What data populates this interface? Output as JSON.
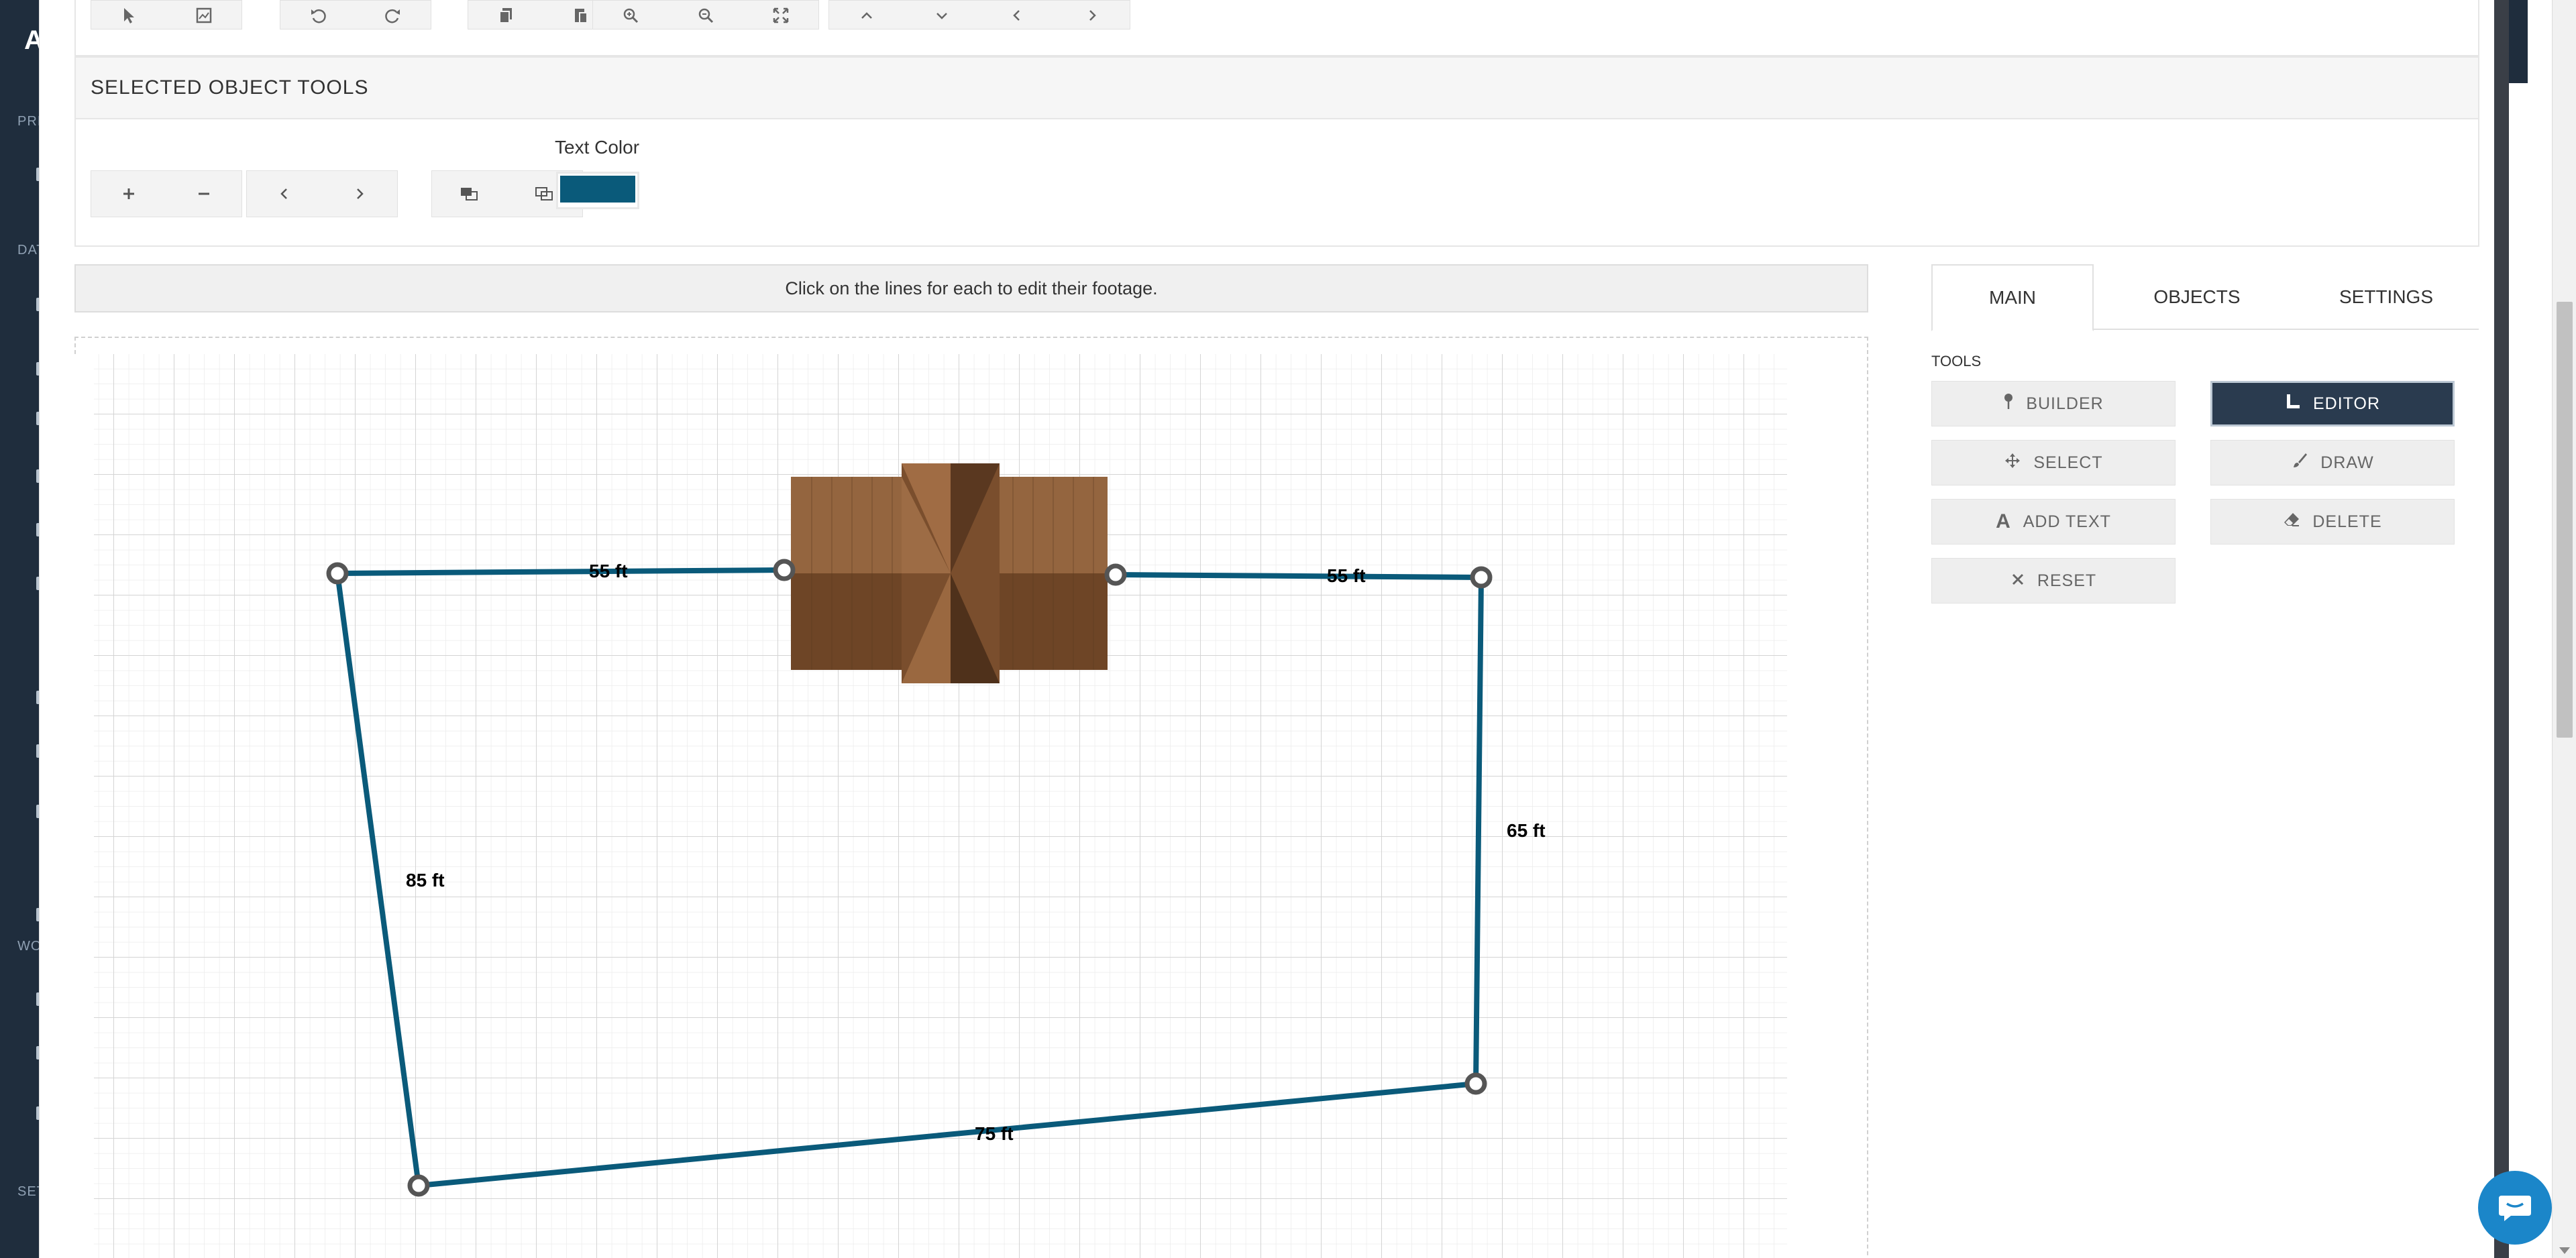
{
  "app_sidebar": {
    "logo": "A",
    "sections": [
      "PRI",
      "DAT",
      "WO",
      "SET"
    ]
  },
  "selected_object_tools": {
    "title": "SELECTED OBJECT TOOLS",
    "text_color_label": "Text Color",
    "text_color": "#0a5a7a"
  },
  "hint": "Click on the lines for each to edit their footage.",
  "diagram": {
    "line_color": "#0a5a7a",
    "labels": [
      "55 ft",
      "55 ft",
      "65 ft",
      "75 ft",
      "85 ft"
    ]
  },
  "tabs": [
    "MAIN",
    "OBJECTS",
    "SETTINGS"
  ],
  "tools": {
    "label": "TOOLS",
    "builder": "BUILDER",
    "editor": "EDITOR",
    "select": "SELECT",
    "draw": "DRAW",
    "add_text": "ADD TEXT",
    "delete": "DELETE",
    "reset": "RESET"
  },
  "icons": {
    "builder": "pin-icon",
    "editor": "ruler-icon",
    "select": "move-icon",
    "draw": "brush-icon",
    "add_text": "text-icon",
    "delete": "eraser-icon",
    "reset": "close-icon",
    "chat": "chat-icon"
  }
}
